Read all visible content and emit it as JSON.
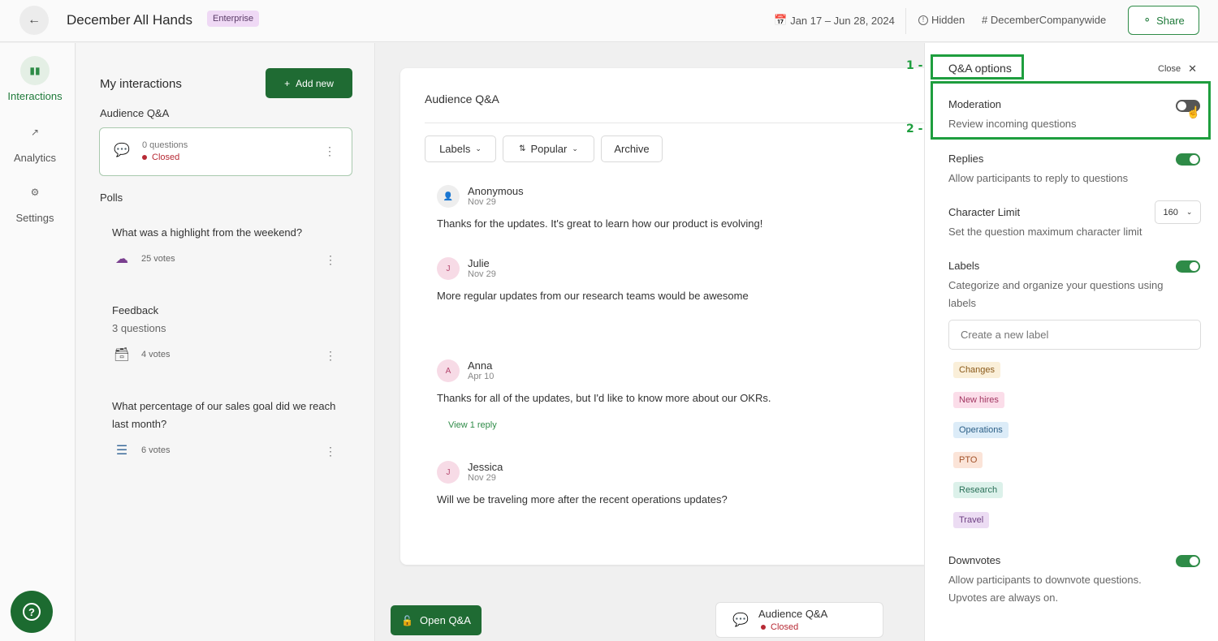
{
  "topbar": {
    "back_icon": "arrow-left-icon",
    "title": "December All Hands",
    "badge": "Enterprise",
    "date_range": "Jan 17 – Jun 28, 2024",
    "visibility": "Hidden",
    "channel": "# DecemberCompanywide",
    "share_label": "Share"
  },
  "rail": {
    "items": [
      {
        "label": "Interactions",
        "icon": "bar-chart-icon",
        "active": true
      },
      {
        "label": "Analytics",
        "icon": "trend-icon",
        "active": false
      },
      {
        "label": "Settings",
        "icon": "gear-icon",
        "active": false
      }
    ],
    "help_label": "?"
  },
  "interactions": {
    "title": "My interactions",
    "add_new_label": "Add new",
    "audience_section": "Audience Q&A",
    "qa_card": {
      "count": "0 questions",
      "status": "Closed"
    },
    "polls_section": "Polls",
    "polls": [
      {
        "question": "What was a highlight from the weekend?",
        "sub": "",
        "votes": "25 votes",
        "icon": "word-cloud-icon"
      },
      {
        "question": "Feedback",
        "sub": "3 questions",
        "votes": "4 votes",
        "icon": "survey-icon"
      },
      {
        "question": "What percentage of our sales goal did we reach last month?",
        "sub": "",
        "votes": "6 votes",
        "icon": "multiple-choice-icon"
      }
    ]
  },
  "qa": {
    "title": "Audience Q&A",
    "filters": {
      "labels": "Labels",
      "popular": "Popular",
      "archive": "Archive"
    },
    "messages": [
      {
        "initial": "",
        "name": "Anonymous",
        "date": "Nov 29",
        "text": "Thanks for the updates. It's great to learn how our product is evolving!"
      },
      {
        "initial": "J",
        "name": "Julie",
        "date": "Nov 29",
        "text": "More regular updates from our research teams would be awesome"
      },
      {
        "initial": "A",
        "name": "Anna",
        "date": "Apr 10",
        "text": "Thanks for all of the updates, but I'd like to know more about our OKRs.",
        "reply": "View 1 reply"
      },
      {
        "initial": "J",
        "name": "Jessica",
        "date": "Nov 29",
        "text": "Will we be traveling more after the recent operations updates?"
      }
    ],
    "open_label": "Open Q&A",
    "bottom_card": {
      "title": "Audience Q&A",
      "status": "Closed"
    }
  },
  "options": {
    "title": "Q&A options",
    "close_label": "Close",
    "moderation": {
      "title": "Moderation",
      "desc": "Review incoming questions",
      "enabled": false
    },
    "replies": {
      "title": "Replies",
      "desc": "Allow participants to reply to questions",
      "enabled": true
    },
    "char_limit": {
      "title": "Character Limit",
      "desc": "Set the question maximum character limit",
      "value": "160"
    },
    "labels": {
      "title": "Labels",
      "desc": "Categorize and organize your questions using labels",
      "enabled": true,
      "placeholder": "Create a new label"
    },
    "chips": [
      {
        "text": "Changes",
        "bg": "#faefd9",
        "fg": "#8a5a1a"
      },
      {
        "text": "New hires",
        "bg": "#fbdde9",
        "fg": "#a23762"
      },
      {
        "text": "Operations",
        "bg": "#dcecf8",
        "fg": "#2c5f86"
      },
      {
        "text": "PTO",
        "bg": "#fbe4d8",
        "fg": "#a2522a"
      },
      {
        "text": "Research",
        "bg": "#dcf1ea",
        "fg": "#2a7058"
      },
      {
        "text": "Travel",
        "bg": "#ecdcf3",
        "fg": "#6d3f82"
      }
    ],
    "downvotes": {
      "title": "Downvotes",
      "desc": "Allow participants to downvote questions. Upvotes are always on.",
      "enabled": true
    }
  },
  "annotations": {
    "one": "1 -",
    "two": "2 -"
  },
  "colors": {
    "accent": "#1f6b33",
    "closed": "#b72a35",
    "annotation": "#1e9e3e"
  }
}
